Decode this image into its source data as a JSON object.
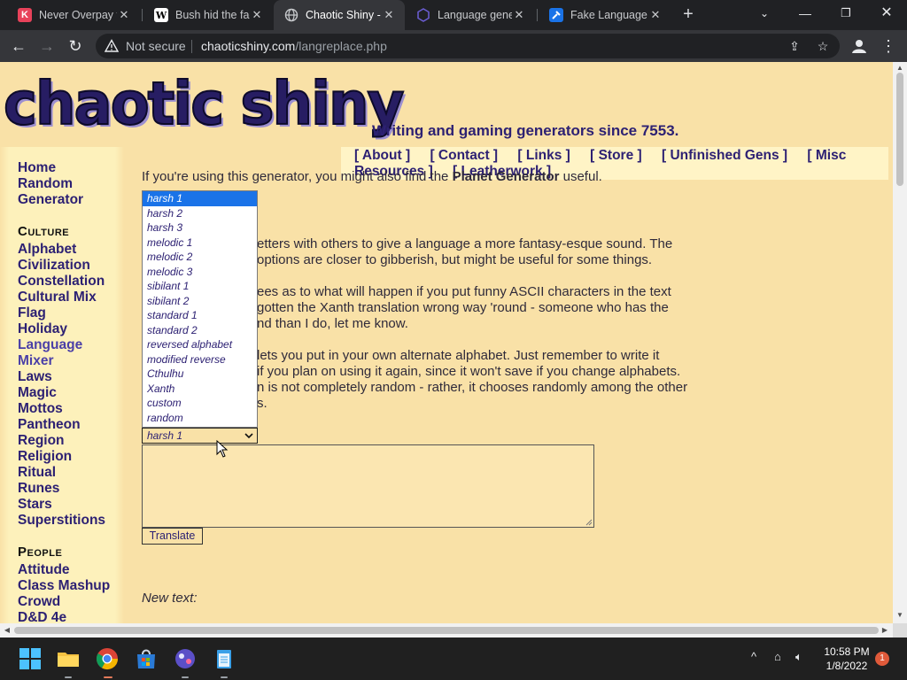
{
  "browser": {
    "tabs": [
      {
        "title": "Never Overpay f",
        "icon": "k-logo-icon",
        "color": "#e8425a"
      },
      {
        "title": "Bush hid the fac",
        "icon": "wikipedia-icon",
        "color": "#ffffff"
      },
      {
        "title": "Chaotic Shiny - L",
        "icon": "globe-icon",
        "color": "#9aa0a6"
      },
      {
        "title": "Language gene",
        "icon": "hexagon-icon",
        "color": "#7a5cff"
      },
      {
        "title": "Fake Language",
        "icon": "tool-icon",
        "color": "#1a73e8"
      }
    ],
    "security_label": "Not secure",
    "url_host": "chaoticshiny.com",
    "url_path": "/langreplace.php"
  },
  "page": {
    "logo": "chaotic shiny",
    "tagline": "Writing and gaming generators since 7553.",
    "topnav": [
      "[ About ]",
      "[ Contact ]",
      "[ Links ]",
      "[ Store ]",
      "[ Unfinished Gens ]",
      "[ Misc",
      "Resources ]",
      "[ Leatherwork ]"
    ],
    "sidebar": {
      "main": [
        "Home",
        "Random",
        "Generator"
      ],
      "culture_head": "Culture",
      "culture": [
        "Alphabet",
        "Civilization",
        "Constellation",
        "Cultural Mix",
        "Flag",
        "Holiday",
        "Language",
        "Mixer",
        "Laws",
        "Magic",
        "Mottos",
        "Pantheon",
        "Region",
        "Religion",
        "Ritual",
        "Runes",
        "Stars",
        "Superstitions"
      ],
      "people_head": "People",
      "people": [
        "Attitude",
        "Class Mashup",
        "Crowd",
        "D&D 4e"
      ]
    },
    "intro_pre": "If you're using this generator, you might also find the",
    "intro_link": "Planet Generator",
    "intro_post": "useful.",
    "desc_lines": [
      "etters with others to give a language a more fantasy-esque sound. The",
      "options are closer to gibberish, but might be useful for some things.",
      "ees as to what will happen if you put funny ASCII characters in the text",
      "gotten the Xanth translation wrong way 'round - someone who has the",
      "nd than I do, let me know.",
      "lets you put in your own alternate alphabet. Just remember to write it",
      "if you plan on using it again, since it won't save if you change alphabets.",
      "n is not completely random - rather, it chooses randomly among the other",
      "s."
    ],
    "dropdown_options": [
      "harsh 1",
      "harsh 2",
      "harsh 3",
      "melodic 1",
      "melodic 2",
      "melodic 3",
      "sibilant 1",
      "sibilant 2",
      "standard 1",
      "standard 2",
      "reversed alphabet",
      "modified reverse",
      "Cthulhu",
      "Xanth",
      "custom",
      "random"
    ],
    "selected_option": "harsh 1",
    "translate_label": "Translate",
    "new_text_label": "New text:"
  },
  "taskbar": {
    "time": "10:58 PM",
    "date": "1/8/2022",
    "notifications": "1"
  }
}
